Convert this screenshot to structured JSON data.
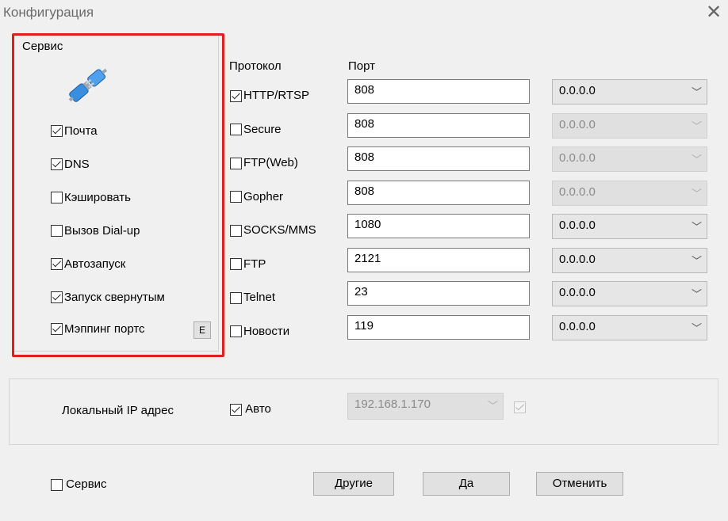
{
  "window": {
    "title": "Конфигурация",
    "close_icon": "close-icon"
  },
  "service_group": {
    "legend": "Сервис",
    "icon": "plug-icon",
    "items": [
      {
        "label": "Почта",
        "checked": true
      },
      {
        "label": "DNS",
        "checked": true
      },
      {
        "label": "Кэшировать",
        "checked": false
      },
      {
        "label": "Вызов Dial-up",
        "checked": false
      },
      {
        "label": "Автозапуск",
        "checked": true
      },
      {
        "label": "Запуск свернутым",
        "checked": true
      },
      {
        "label": "Мэппинг портс",
        "checked": true
      }
    ],
    "mapping_button": "E"
  },
  "protocols": {
    "header_protocol": "Протокол",
    "header_port": "Порт",
    "rows": [
      {
        "name": "HTTP/RTSP",
        "checked": true,
        "port": "808",
        "ip": "0.0.0.0",
        "ip_enabled": true
      },
      {
        "name": "Secure",
        "checked": false,
        "port": "808",
        "ip": "0.0.0.0",
        "ip_enabled": false
      },
      {
        "name": "FTP(Web)",
        "checked": false,
        "port": "808",
        "ip": "0.0.0.0",
        "ip_enabled": false
      },
      {
        "name": "Gopher",
        "checked": false,
        "port": "808",
        "ip": "0.0.0.0",
        "ip_enabled": false
      },
      {
        "name": "SOCKS/MMS",
        "checked": false,
        "port": "1080",
        "ip": "0.0.0.0",
        "ip_enabled": true
      },
      {
        "name": "FTP",
        "checked": false,
        "port": "2121",
        "ip": "0.0.0.0",
        "ip_enabled": true
      },
      {
        "name": "Telnet",
        "checked": false,
        "port": "23",
        "ip": "0.0.0.0",
        "ip_enabled": true
      },
      {
        "name": "Новости",
        "checked": false,
        "port": "119",
        "ip": "0.0.0.0",
        "ip_enabled": true
      }
    ]
  },
  "local_ip": {
    "label": "Локальный IP адрес",
    "auto_label": "Авто",
    "auto_checked": true,
    "ip_value": "192.168.1.170",
    "extra_checked": true
  },
  "footer": {
    "service_label": "Сервис",
    "service_checked": false,
    "other_button": "Другие",
    "ok_button": "Да",
    "cancel_button": "Отменить"
  }
}
